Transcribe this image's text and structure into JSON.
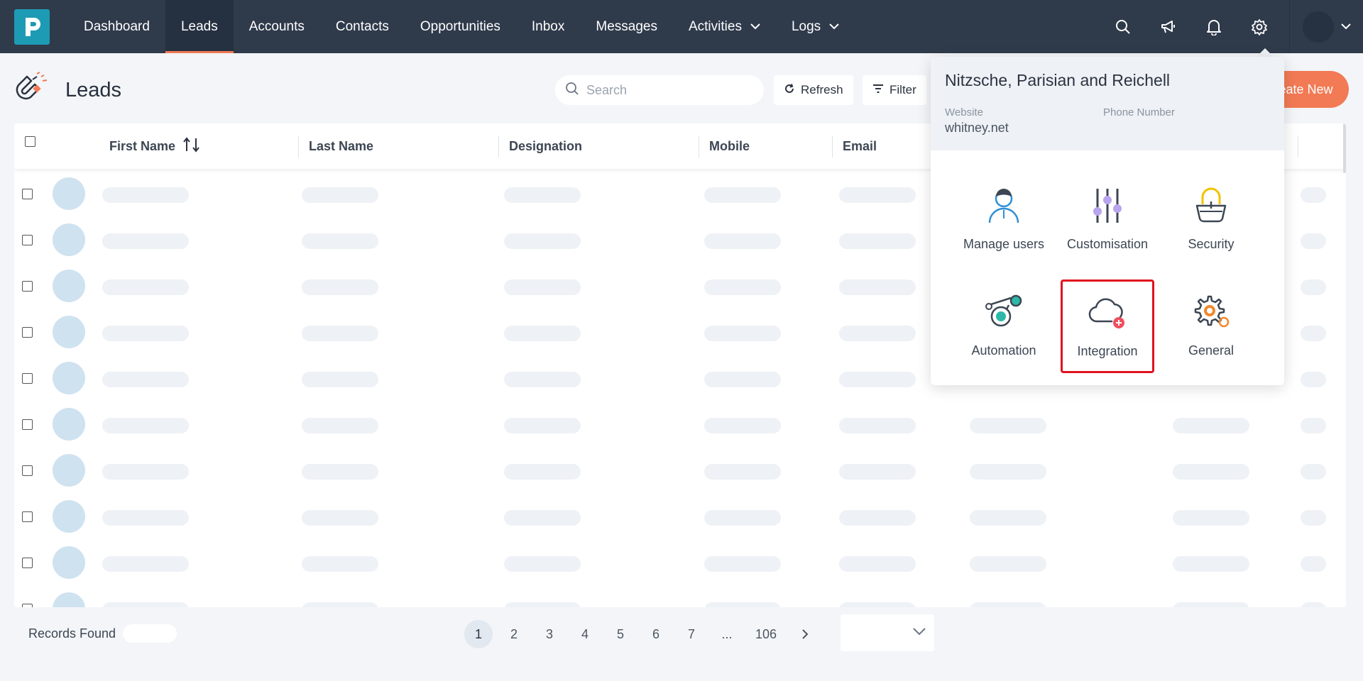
{
  "nav": {
    "items": [
      {
        "label": "Dashboard",
        "active": false,
        "has_menu": false
      },
      {
        "label": "Leads",
        "active": true,
        "has_menu": false
      },
      {
        "label": "Accounts",
        "active": false,
        "has_menu": false
      },
      {
        "label": "Contacts",
        "active": false,
        "has_menu": false
      },
      {
        "label": "Opportunities",
        "active": false,
        "has_menu": false
      },
      {
        "label": "Inbox",
        "active": false,
        "has_menu": false
      },
      {
        "label": "Messages",
        "active": false,
        "has_menu": false
      },
      {
        "label": "Activities",
        "active": true,
        "has_menu": true
      },
      {
        "label": "Logs",
        "active": false,
        "has_menu": true
      }
    ],
    "icons": [
      "search-icon",
      "megaphone-icon",
      "bell-icon",
      "gear-icon"
    ],
    "accent": "#f27a55",
    "background": "#2f3a4b"
  },
  "page": {
    "title": "Leads",
    "search_placeholder": "Search",
    "refresh_label": "Refresh",
    "filter_label": "Filter",
    "create_label": "Create New"
  },
  "table": {
    "columns": [
      "First Name",
      "Last Name",
      "Designation",
      "Mobile",
      "Email"
    ],
    "loading_rows": 10
  },
  "pagination": {
    "records_label": "Records Found",
    "pages": [
      "1",
      "2",
      "3",
      "4",
      "5",
      "6",
      "7",
      "...",
      "106"
    ],
    "current_page": "1",
    "next_icon": "chevron-right-icon"
  },
  "settings_menu": {
    "company": "Nitzsche, Parisian and Reichell",
    "website_label": "Website",
    "website_value": "whitney.net",
    "phone_label": "Phone Number",
    "tiles": [
      {
        "label": "Manage users",
        "icon": "user-icon"
      },
      {
        "label": "Customisation",
        "icon": "sliders-icon"
      },
      {
        "label": "Security",
        "icon": "lock-icon"
      },
      {
        "label": "Automation",
        "icon": "automation-icon"
      },
      {
        "label": "Integration",
        "icon": "cloud-plus-icon",
        "highlighted": true
      },
      {
        "label": "General",
        "icon": "gears-icon"
      }
    ]
  }
}
